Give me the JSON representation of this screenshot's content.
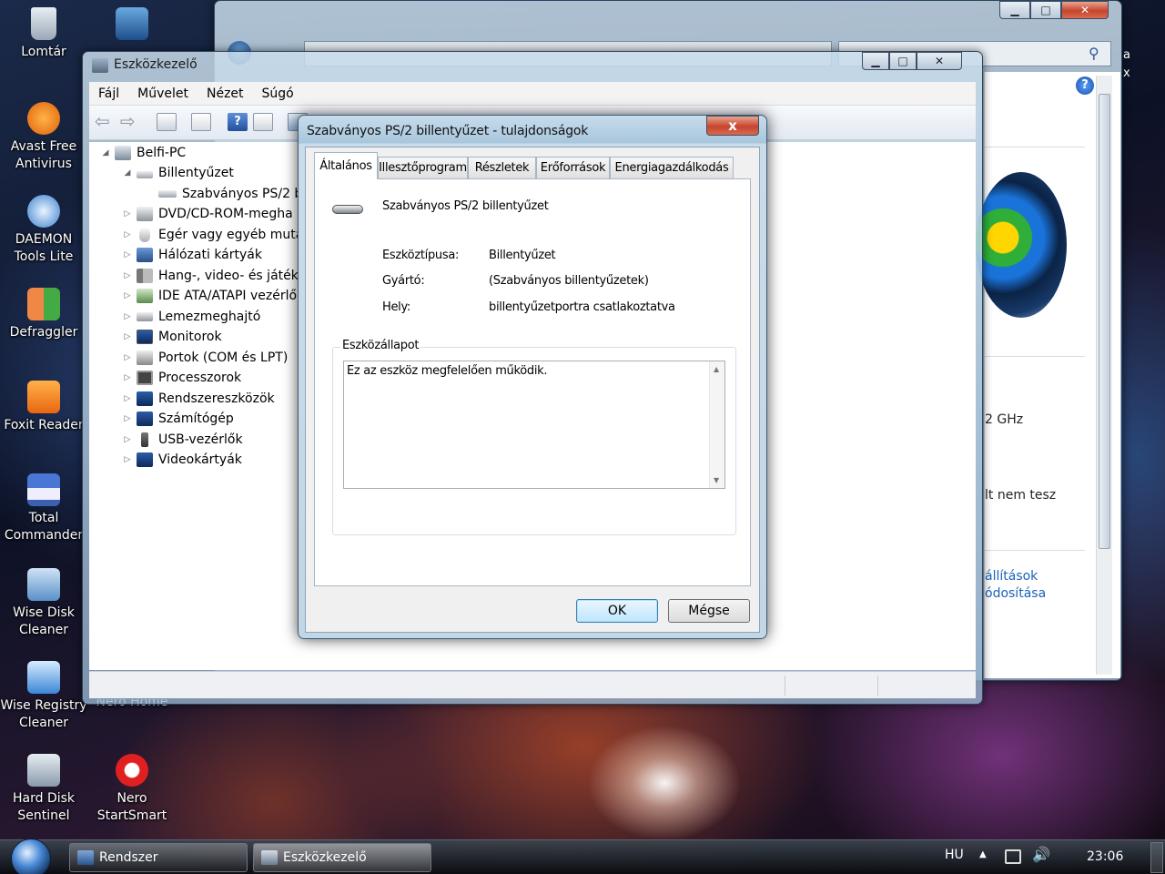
{
  "desktop": {
    "icons": [
      {
        "label": "Lomtár"
      },
      {
        "label": "Avast Free Antivirus"
      },
      {
        "label": "DAEMON Tools Lite"
      },
      {
        "label": "Defraggler"
      },
      {
        "label": "Foxit Reader"
      },
      {
        "label": "Total Commander"
      },
      {
        "label": "Wise Disk Cleaner"
      },
      {
        "label": "Wise Registry Cleaner"
      },
      {
        "label": "Hard Disk Sentinel"
      },
      {
        "label": "Nero StartSmart"
      },
      {
        "label": "Nero Home"
      }
    ]
  },
  "background_window": {
    "speed_text": "2 GHz",
    "text_line": "lt nem tesz",
    "link1": "állítások",
    "link2": "ódosítása",
    "side_text": "a x"
  },
  "device_manager": {
    "title": "Eszközkezelő",
    "menu": [
      "Fájl",
      "Művelet",
      "Nézet",
      "Súgó"
    ],
    "tree": [
      {
        "label": "Belfi-PC",
        "level": 0,
        "expanded": true
      },
      {
        "label": "Billentyűzet",
        "level": 1,
        "expanded": true
      },
      {
        "label": "Szabványos PS/2 b",
        "level": 2
      },
      {
        "label": "DVD/CD-ROM-megha",
        "level": 1
      },
      {
        "label": "Egér vagy egyéb muta",
        "level": 1
      },
      {
        "label": "Hálózati kártyák",
        "level": 1
      },
      {
        "label": "Hang-, video- és játék",
        "level": 1
      },
      {
        "label": "IDE ATA/ATAPI vezérlő",
        "level": 1
      },
      {
        "label": "Lemezmeghajtó",
        "level": 1
      },
      {
        "label": "Monitorok",
        "level": 1
      },
      {
        "label": "Portok (COM és LPT)",
        "level": 1
      },
      {
        "label": "Processzorok",
        "level": 1
      },
      {
        "label": "Rendszereszközök",
        "level": 1
      },
      {
        "label": "Számítógép",
        "level": 1
      },
      {
        "label": "USB-vezérlők",
        "level": 1
      },
      {
        "label": "Videokártyák",
        "level": 1
      }
    ]
  },
  "dialog": {
    "title": "Szabványos PS/2 billentyűzet - tulajdonságok",
    "tabs": [
      "Általános",
      "Illesztőprogram",
      "Részletek",
      "Erőforrások",
      "Energiagazdálkodás"
    ],
    "active_tab": "Általános",
    "device_name": "Szabványos PS/2 billentyűzet",
    "properties": [
      {
        "label": "Eszköztípusa:",
        "value": "Billentyűzet"
      },
      {
        "label": "Gyártó:",
        "value": "(Szabványos billentyűzetek)"
      },
      {
        "label": "Hely:",
        "value": "billentyűzetportra csatlakoztatva"
      }
    ],
    "status_group_label": "Eszközállapot",
    "status_text": "Ez az eszköz megfelelően működik.",
    "ok_label": "OK",
    "cancel_label": "Mégse",
    "close_glyph": "x"
  },
  "taskbar": {
    "buttons": [
      "Rendszer",
      "Eszközkezelő"
    ],
    "language": "HU",
    "time": "23:06"
  },
  "colors": {
    "accent": "#3c7fb1",
    "link": "#1a63b8",
    "close_red": "#c6452e"
  }
}
